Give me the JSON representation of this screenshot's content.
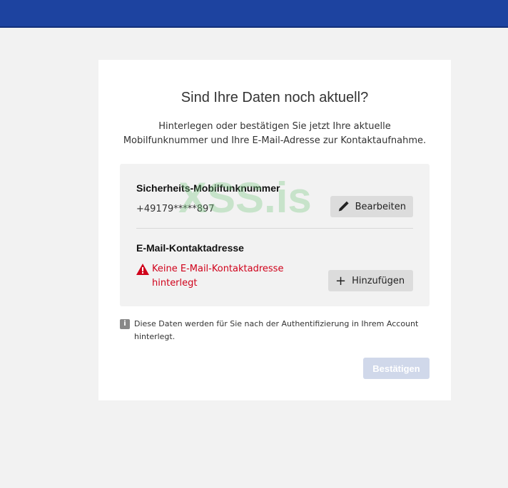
{
  "header": {
    "color": "#1d43a0"
  },
  "card": {
    "title": "Sind Ihre Daten noch aktuell?",
    "subtitle_line1": "Hinterlegen oder bestätigen Sie jetzt Ihre aktuelle",
    "subtitle_line2": "Mobilfunknummer und Ihre E-Mail-Adresse zur Kontaktaufnahme.",
    "phone": {
      "label": "Sicherheits-Mobilfunknummer",
      "value": "+49179*****897",
      "button": "Bearbeiten",
      "icon": "pencil-icon"
    },
    "email": {
      "label": "E-Mail-Kontaktadresse",
      "error": "Keine E-Mail-Kontaktadresse hinterlegt",
      "error_color": "#d0021b",
      "icon": "warning-icon",
      "button": "Hinzufügen",
      "button_icon": "plus-icon"
    },
    "info": {
      "icon": "info-icon",
      "text": "Diese Daten werden für Sie nach der Authentifizierung in Ihrem Account hinterlegt."
    },
    "confirm_button": "Bestätigen"
  },
  "watermark": "XSS.is"
}
